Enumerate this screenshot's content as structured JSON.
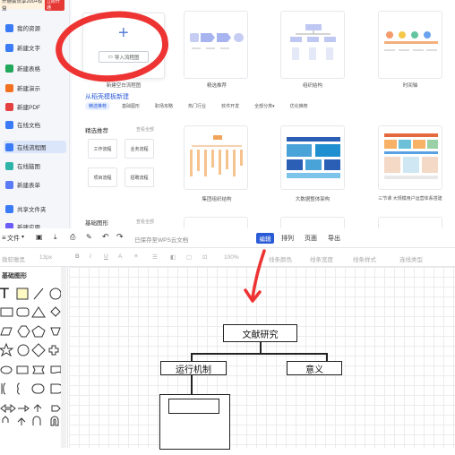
{
  "promo": {
    "text": "开通会员享200+权益",
    "badge": "立即开通"
  },
  "sidebar": {
    "items": [
      {
        "label": "我的资源",
        "color": "#3b7bf6"
      },
      {
        "label": "新建文字",
        "color": "#3b7bf6"
      },
      {
        "label": "新建表格",
        "color": "#22a85a"
      },
      {
        "label": "新建演示",
        "color": "#f37021"
      },
      {
        "label": "新建PDF",
        "color": "#e54040"
      },
      {
        "label": "在线文档",
        "color": "#3b7bf6"
      },
      {
        "label": "在线流程图",
        "color": "#3b7bf6"
      },
      {
        "label": "在线脑图",
        "color": "#2fb5a7"
      },
      {
        "label": "新建表单",
        "color": "#5b7cf6"
      },
      {
        "label": "共享文件夹",
        "color": "#3b7bf6"
      },
      {
        "label": "新建应用",
        "color": "#6a5cf6"
      }
    ]
  },
  "top": {
    "new_blank_caption": "新建空白流程图",
    "import_button": "导入流程图",
    "plus": "+",
    "templates": [
      {
        "caption": "精选推荐"
      },
      {
        "caption": "组织结构"
      },
      {
        "caption": "时间轴"
      }
    ],
    "source_title": "从稻壳模板新建",
    "tabs": [
      "精选推荐",
      "基础图形",
      "职场攻略",
      "热门行业",
      "软件开发",
      "全部分类▾",
      "优化推荐"
    ],
    "featured_title": "精选推荐",
    "see_all": "查看全部",
    "type_buttons": [
      "工作流程",
      "业务流程",
      "项目流程",
      "招聘流程"
    ],
    "featured_cards": [
      {
        "caption": "集团组织结构"
      },
      {
        "caption": "大数据整体架构"
      },
      {
        "caption": "三节课 大规模用户运营体系搭建"
      }
    ],
    "basic_title": "基础图形",
    "basic_see_all": "查看全部"
  },
  "editor": {
    "file_menu": "文件",
    "saved_status": "已保存至WPS云文档",
    "tabs": [
      "编辑",
      "排列",
      "页面",
      "导出"
    ],
    "font_name": "微软雅黑",
    "font_size": "13px",
    "zoom": "100%",
    "line_color": "线条颜色",
    "line_width": "线条宽度",
    "line_style": "线条样式",
    "connector_type": "连线类型",
    "shapes_title": "基础图形",
    "text_tool": "T"
  },
  "diagram": {
    "root": "文献研究",
    "left": "运行机制",
    "right": "意义",
    "child": ""
  },
  "colors": {
    "accent": "#2a5bd7",
    "annotation": "#ee3333"
  }
}
